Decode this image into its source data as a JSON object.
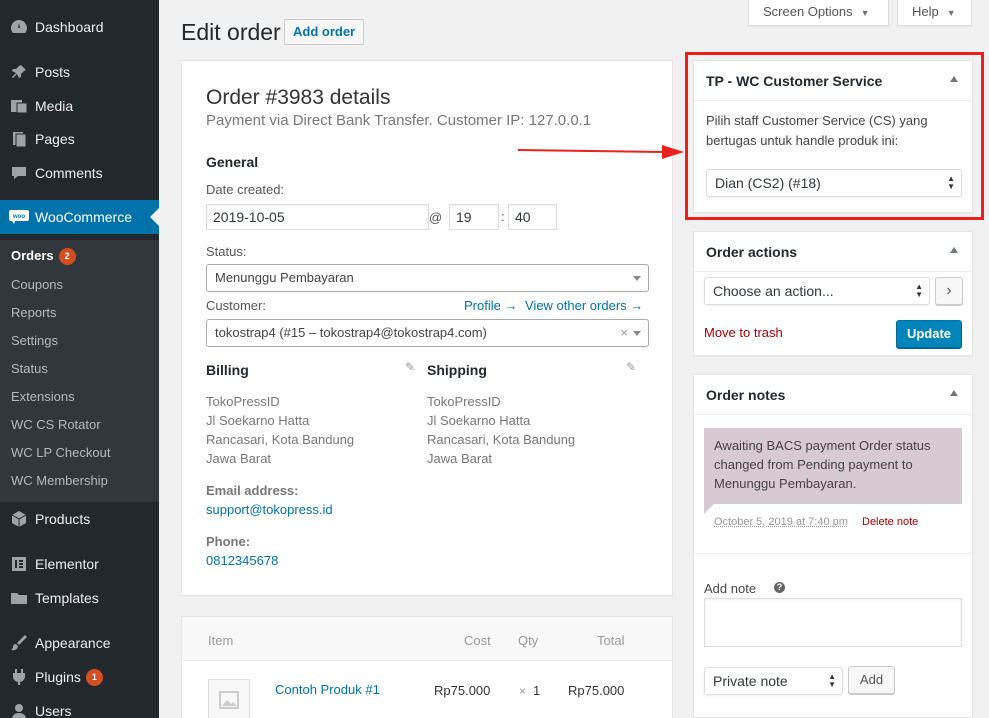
{
  "sidebar": {
    "items": [
      {
        "label": "Dashboard",
        "icon": "dashboard-icon",
        "glyph": "◕"
      },
      {
        "label": "Posts",
        "icon": "pin-icon",
        "glyph": "✎"
      },
      {
        "label": "Media",
        "icon": "media-icon",
        "glyph": "▣"
      },
      {
        "label": "Pages",
        "icon": "pages-icon",
        "glyph": "▤"
      },
      {
        "label": "Comments",
        "icon": "comment-icon",
        "glyph": "▬"
      },
      {
        "label": "WooCommerce",
        "icon": "woo-icon",
        "glyph": "woo"
      },
      {
        "label": "Products",
        "icon": "products-icon",
        "glyph": "◆"
      },
      {
        "label": "Elementor",
        "icon": "elementor-icon",
        "glyph": "▥"
      },
      {
        "label": "Templates",
        "icon": "folder-icon",
        "glyph": "▰"
      },
      {
        "label": "Appearance",
        "icon": "brush-icon",
        "glyph": "✐"
      },
      {
        "label": "Plugins",
        "icon": "plugin-icon",
        "glyph": "⚡",
        "badge": "1"
      },
      {
        "label": "Users",
        "icon": "users-icon",
        "glyph": "●"
      }
    ],
    "submenu": [
      {
        "label": "Orders",
        "badge": "2"
      },
      {
        "label": "Coupons"
      },
      {
        "label": "Reports"
      },
      {
        "label": "Settings"
      },
      {
        "label": "Status"
      },
      {
        "label": "Extensions"
      },
      {
        "label": "WC CS Rotator"
      },
      {
        "label": "WC LP Checkout"
      },
      {
        "label": "WC Membership"
      }
    ]
  },
  "header": {
    "title": "Edit order",
    "add_order": "Add order",
    "screen_options": "Screen Options",
    "help": "Help"
  },
  "order": {
    "heading": "Order #3983 details",
    "meta": "Payment via Direct Bank Transfer. Customer IP: 127.0.0.1",
    "general": "General",
    "date_label": "Date created:",
    "date": "2019-10-05",
    "at": "@",
    "hour": "19",
    "colon": ":",
    "minute": "40",
    "status_label": "Status:",
    "status": "Menunggu Pembayaran",
    "customer_label": "Customer:",
    "profile_link": "Profile →",
    "other_orders_link": "View other orders →",
    "customer": "tokostrap4 (#15 – tokostrap4@tokostrap4.com)",
    "clear": "×",
    "billing": {
      "title": "Billing",
      "lines": [
        "TokoPressID",
        "Jl Soekarno Hatta",
        "Rancasari, Kota Bandung",
        "Jawa Barat"
      ],
      "email_label": "Email address:",
      "email": "support@tokopress.id",
      "phone_label": "Phone:",
      "phone": "0812345678"
    },
    "shipping": {
      "title": "Shipping",
      "lines": [
        "TokoPressID",
        "Jl Soekarno Hatta",
        "Rancasari, Kota Bandung",
        "Jawa Barat"
      ]
    }
  },
  "items": {
    "headers": {
      "item": "Item",
      "cost": "Cost",
      "qty": "Qty",
      "total": "Total"
    },
    "rows": [
      {
        "name": "Contoh Produk #1",
        "cost": "Rp75.000",
        "qty_x": "×",
        "qty": "1",
        "total": "Rp75.000"
      }
    ]
  },
  "cs_box": {
    "title": "TP - WC Customer Service",
    "description": "Pilih staff Customer Service (CS) yang bertugas untuk handle produk ini:",
    "selected": "Dian (CS2) (#18)"
  },
  "actions_box": {
    "title": "Order actions",
    "select": "Choose an action...",
    "go": "›",
    "trash": "Move to trash",
    "update": "Update"
  },
  "notes_box": {
    "title": "Order notes",
    "note": "Awaiting BACS payment Order status changed from Pending payment to Menunggu Pembayaran.",
    "note_date": "October 5, 2019 at 7:40 pm",
    "delete": "Delete note",
    "add_label": "Add note",
    "help": "?",
    "type": "Private note",
    "add_button": "Add"
  },
  "colors": {
    "sidebar": "#23282d",
    "submenu": "#32373c",
    "accent": "#0073aa",
    "note_bg": "#d7cad2",
    "highlight": "#e8211e",
    "badge": "#d54e21"
  }
}
